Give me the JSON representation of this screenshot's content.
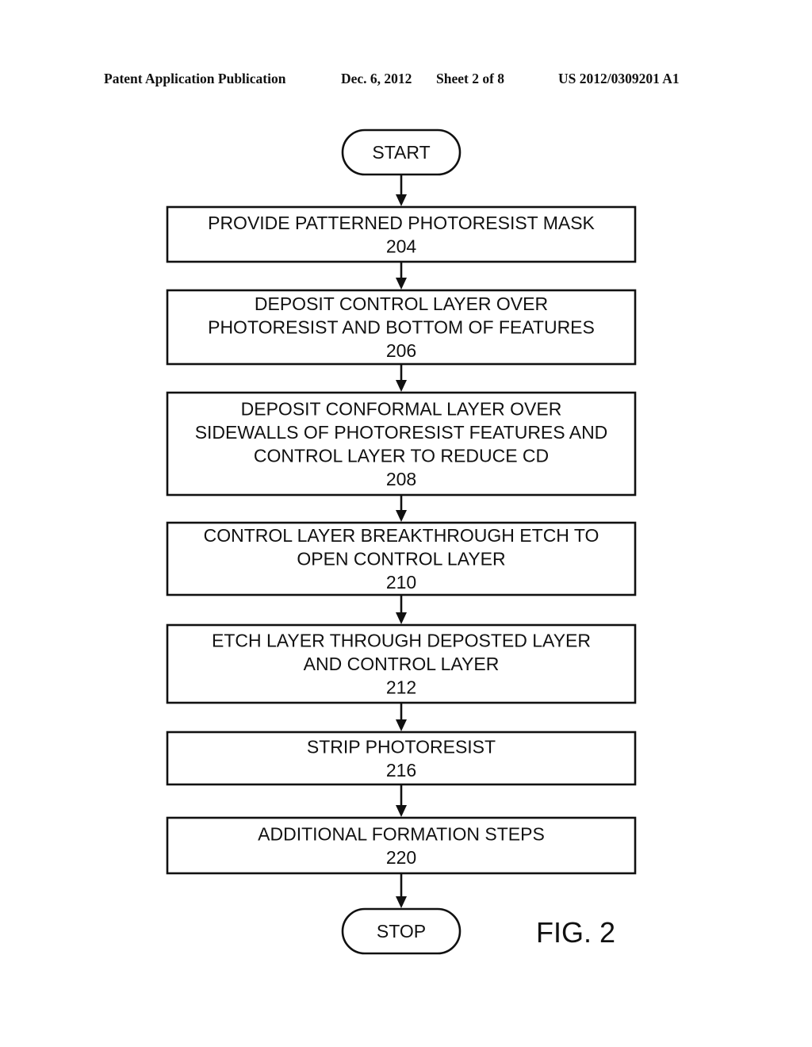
{
  "header": {
    "publication": "Patent Application Publication",
    "date": "Dec. 6, 2012",
    "sheet": "Sheet 2 of 8",
    "number": "US 2012/0309201 A1"
  },
  "flowchart": {
    "start_label": "START",
    "stop_label": "STOP",
    "figure_label": "FIG. 2",
    "steps": [
      {
        "lines": [
          "PROVIDE PATTERNED PHOTORESIST MASK"
        ],
        "ref": "204"
      },
      {
        "lines": [
          "DEPOSIT CONTROL LAYER OVER",
          "PHOTORESIST AND BOTTOM OF FEATURES"
        ],
        "ref": "206"
      },
      {
        "lines": [
          "DEPOSIT CONFORMAL LAYER OVER",
          "SIDEWALLS OF PHOTORESIST FEATURES AND",
          "CONTROL LAYER TO REDUCE CD"
        ],
        "ref": "208"
      },
      {
        "lines": [
          "CONTROL LAYER BREAKTHROUGH ETCH TO",
          "OPEN CONTROL LAYER"
        ],
        "ref": "210"
      },
      {
        "lines": [
          "ETCH LAYER THROUGH DEPOSTED LAYER",
          "AND CONTROL LAYER"
        ],
        "ref": "212"
      },
      {
        "lines": [
          "STRIP PHOTORESIST"
        ],
        "ref": "216"
      },
      {
        "lines": [
          "ADDITIONAL FORMATION STEPS"
        ],
        "ref": "220"
      }
    ]
  }
}
